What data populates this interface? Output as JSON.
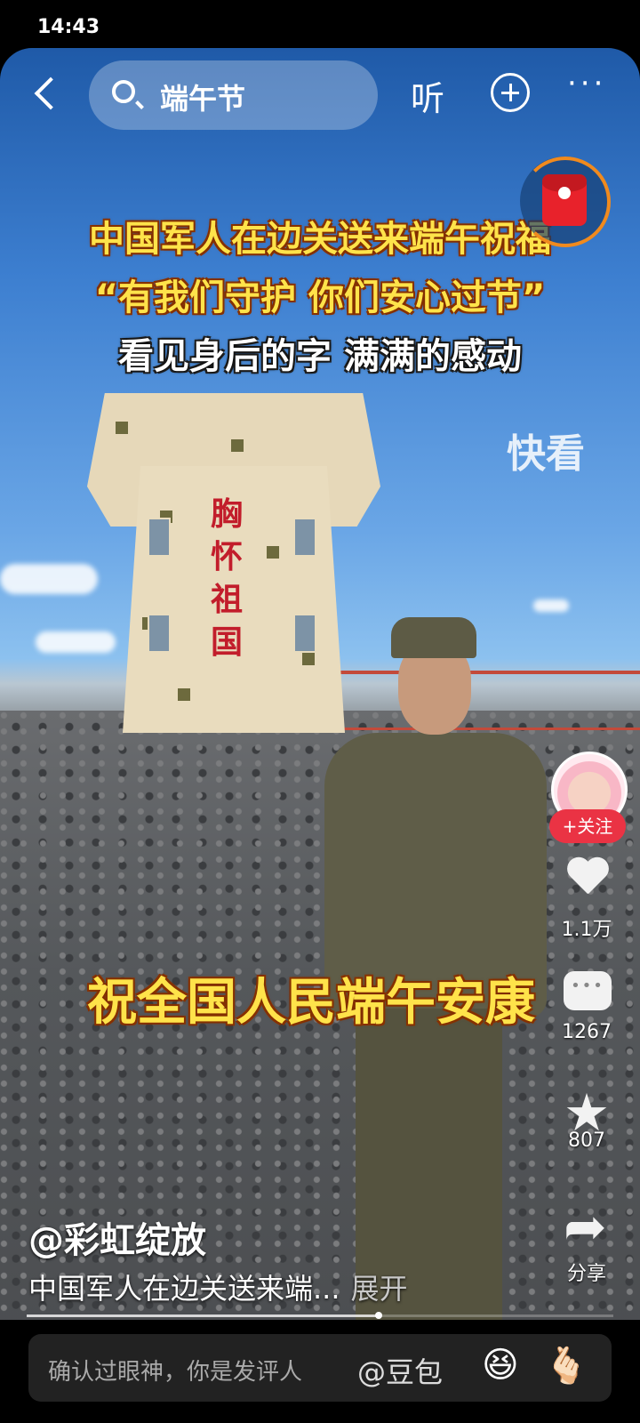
{
  "status_bar": {
    "time": "14:43"
  },
  "top_bar": {
    "search_query": "端午节",
    "listen_label": "听",
    "more_label": "···"
  },
  "video": {
    "caption_line1": "中国军人在边关送来端午祝福",
    "caption_line2": "“有我们守护 你们安心过节”",
    "caption_line3": "看见身后的字 满满的感动",
    "tower_text": [
      "胸",
      "怀",
      "祖",
      "国"
    ],
    "watermark": "快看",
    "bottom_caption": "祝全国人民端午安康",
    "progress": 0.6
  },
  "actions": {
    "follow_label": "+关注",
    "likes": "1.1万",
    "comments": "1267",
    "favorites": "807",
    "share_label": "分享"
  },
  "post": {
    "author": "@彩虹绽放",
    "description": "中国军人在边关送来端...",
    "expand_label": "展开"
  },
  "comment_bar": {
    "placeholder": "确认过眼神，你是发评人",
    "mention": "@豆包",
    "emoji1": "😆",
    "emoji2": "🫰🏻"
  }
}
